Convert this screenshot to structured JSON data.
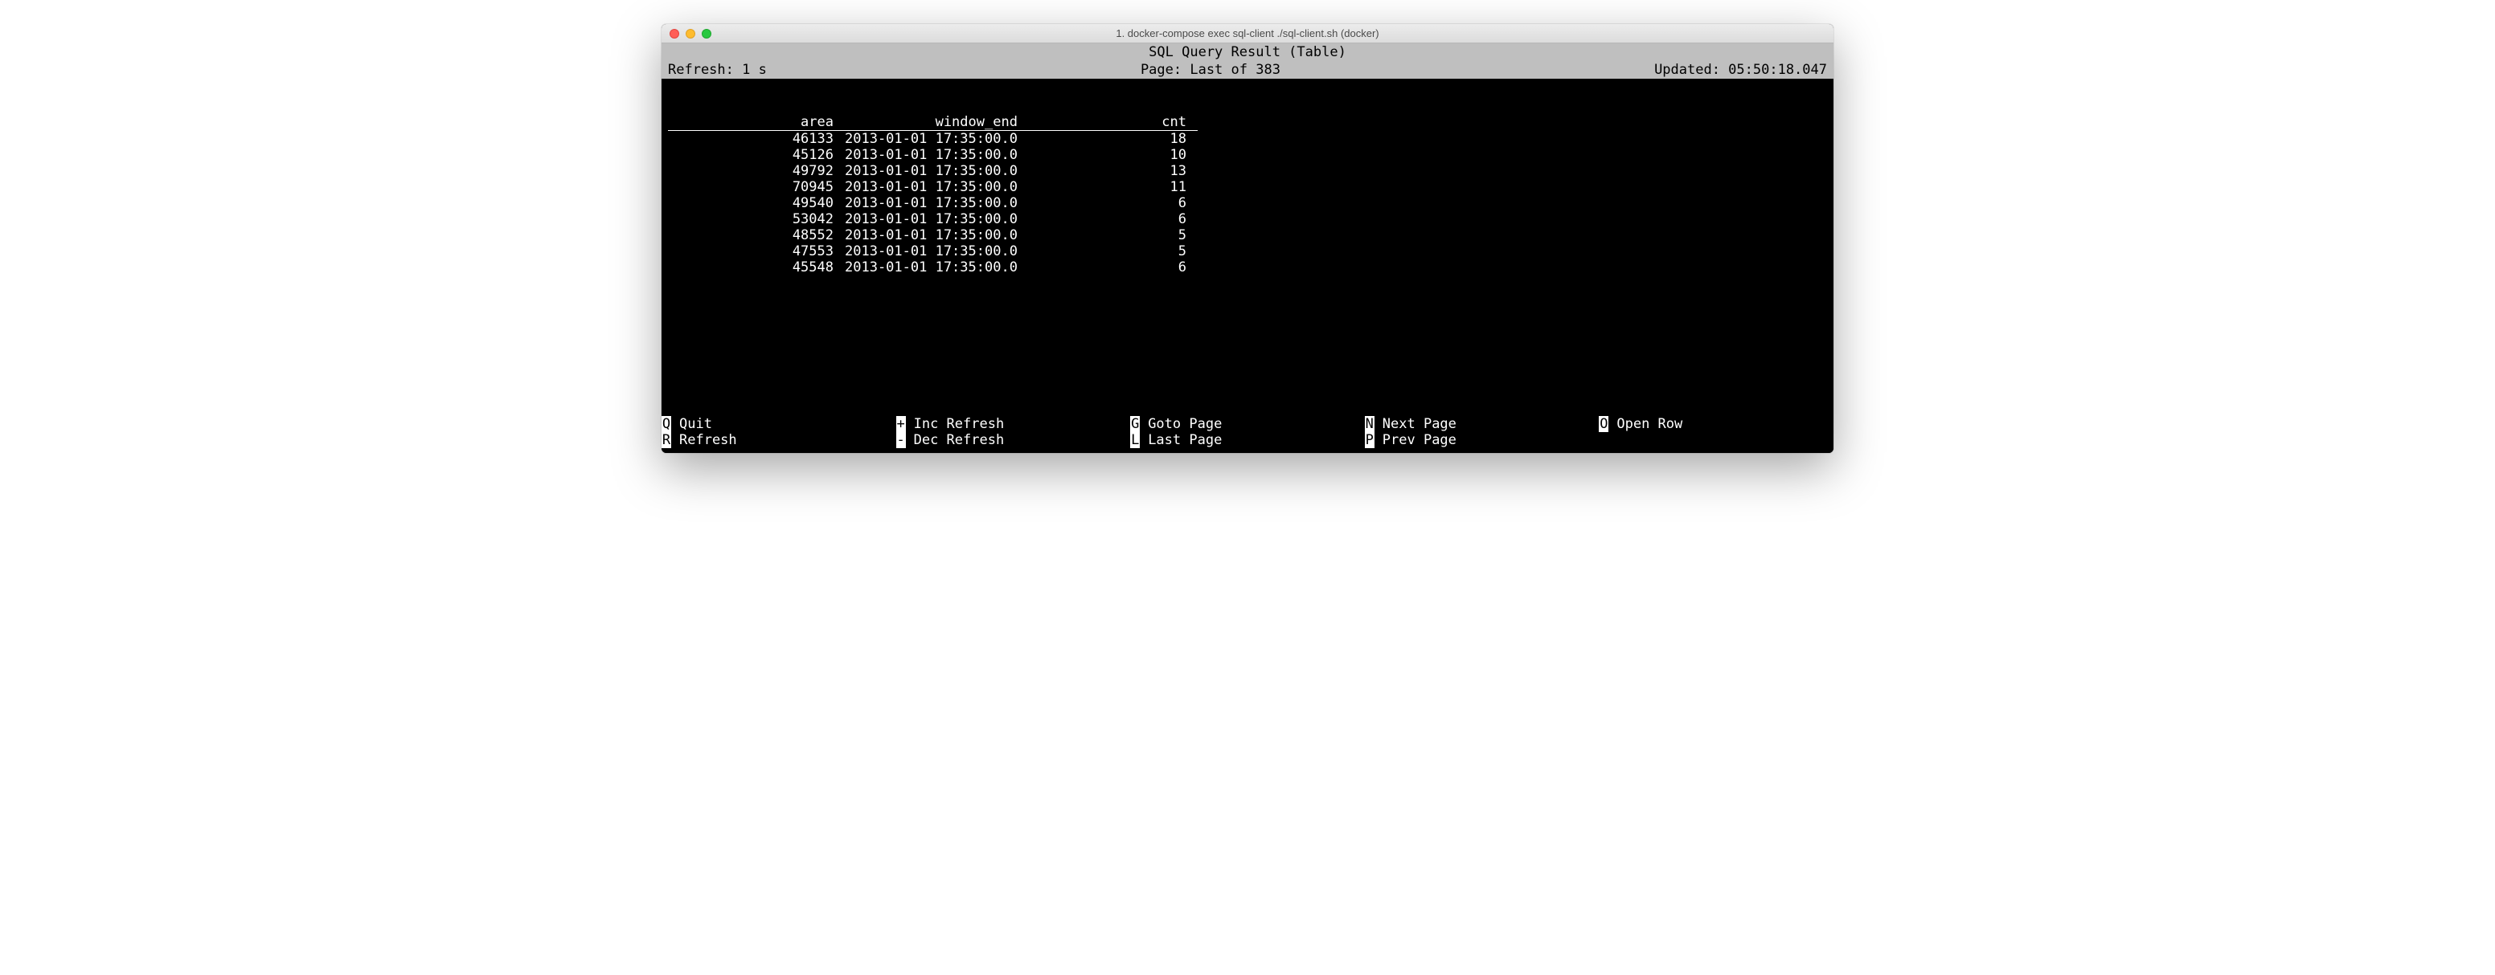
{
  "window": {
    "title": "1. docker-compose exec sql-client ./sql-client.sh (docker)"
  },
  "header": {
    "title": "SQL Query Result (Table)",
    "refresh": "Refresh: 1 s",
    "page": "Page: Last of 383",
    "updated": "Updated: 05:50:18.047"
  },
  "table": {
    "columns": [
      "area",
      "window_end",
      "cnt"
    ],
    "rows": [
      {
        "area": "46133",
        "window_end": "2013-01-01 17:35:00.0",
        "cnt": "18"
      },
      {
        "area": "45126",
        "window_end": "2013-01-01 17:35:00.0",
        "cnt": "10"
      },
      {
        "area": "49792",
        "window_end": "2013-01-01 17:35:00.0",
        "cnt": "13"
      },
      {
        "area": "70945",
        "window_end": "2013-01-01 17:35:00.0",
        "cnt": "11"
      },
      {
        "area": "49540",
        "window_end": "2013-01-01 17:35:00.0",
        "cnt": "6"
      },
      {
        "area": "53042",
        "window_end": "2013-01-01 17:35:00.0",
        "cnt": "6"
      },
      {
        "area": "48552",
        "window_end": "2013-01-01 17:35:00.0",
        "cnt": "5"
      },
      {
        "area": "47553",
        "window_end": "2013-01-01 17:35:00.0",
        "cnt": "5"
      },
      {
        "area": "45548",
        "window_end": "2013-01-01 17:35:00.0",
        "cnt": "6"
      }
    ]
  },
  "footer": {
    "cols": [
      [
        {
          "key": "Q",
          "label": "Quit"
        },
        {
          "key": "R",
          "label": "Refresh"
        }
      ],
      [
        {
          "key": "+",
          "label": "Inc Refresh"
        },
        {
          "key": "-",
          "label": "Dec Refresh"
        }
      ],
      [
        {
          "key": "G",
          "label": "Goto Page"
        },
        {
          "key": "L",
          "label": "Last Page"
        }
      ],
      [
        {
          "key": "N",
          "label": "Next Page"
        },
        {
          "key": "P",
          "label": "Prev Page"
        }
      ],
      [
        {
          "key": "O",
          "label": "Open Row"
        }
      ]
    ]
  }
}
